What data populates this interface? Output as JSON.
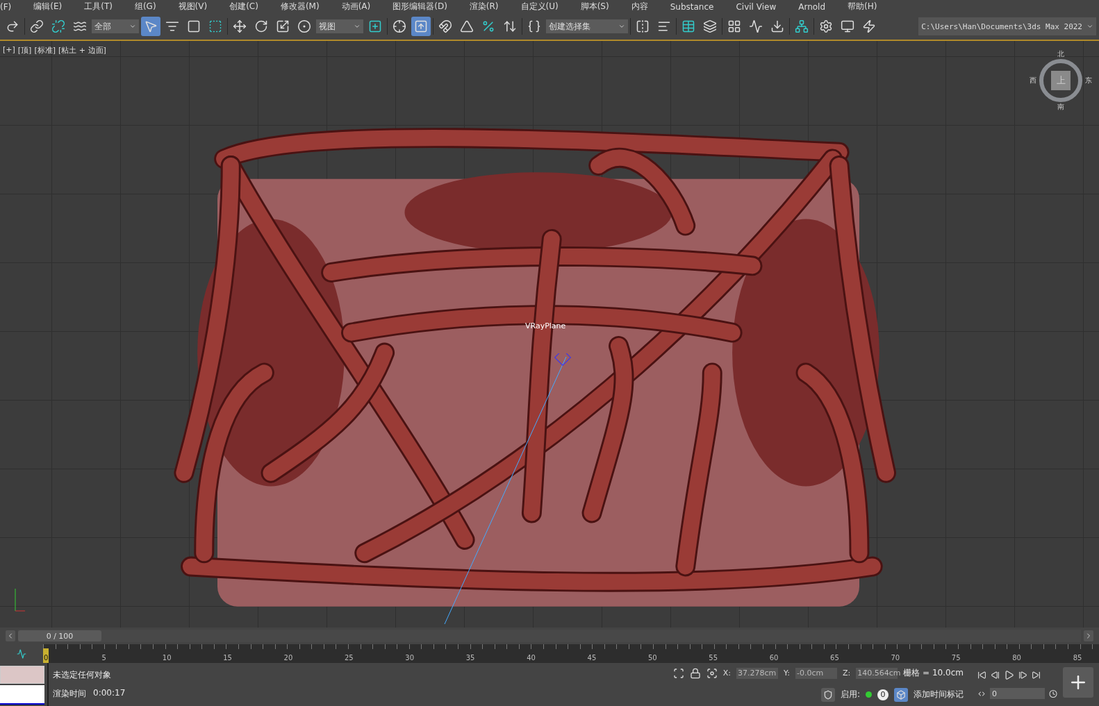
{
  "menu": [
    "(F)",
    "编辑(E)",
    "工具(T)",
    "组(G)",
    "视图(V)",
    "创建(C)",
    "修改器(M)",
    "动画(A)",
    "图形编辑器(D)",
    "渲染(R)",
    "自定义(U)",
    "脚本(S)",
    "内容",
    "Substance",
    "Civil View",
    "Arnold",
    "帮助(H)"
  ],
  "toolbar": [
    {
      "kind": "button",
      "selected": false
    },
    {
      "kind": "sep"
    },
    {
      "kind": "button",
      "selected": false
    },
    {
      "kind": "button",
      "selected": false
    },
    {
      "kind": "button",
      "selected": false
    },
    {
      "kind": "dropdown",
      "value": "全部"
    },
    {
      "kind": "button",
      "selected": true
    },
    {
      "kind": "button",
      "selected": false
    },
    {
      "kind": "button",
      "selected": false
    },
    {
      "kind": "button",
      "selected": false
    },
    {
      "kind": "sep"
    },
    {
      "kind": "button",
      "selected": false
    },
    {
      "kind": "button",
      "selected": false
    },
    {
      "kind": "button",
      "selected": false
    },
    {
      "kind": "button",
      "selected": false
    },
    {
      "kind": "dropdown",
      "value": "视图"
    },
    {
      "kind": "button",
      "selected": false
    },
    {
      "kind": "sep"
    },
    {
      "kind": "button",
      "selected": false
    },
    {
      "kind": "button",
      "selected": true
    },
    {
      "kind": "sep"
    },
    {
      "kind": "button",
      "selected": false
    },
    {
      "kind": "button",
      "selected": false
    },
    {
      "kind": "button",
      "selected": false
    },
    {
      "kind": "button",
      "selected": false
    },
    {
      "kind": "sep"
    },
    {
      "kind": "button",
      "selected": false
    },
    {
      "kind": "dropdown",
      "value": "创建选择集"
    },
    {
      "kind": "sep"
    },
    {
      "kind": "button",
      "selected": false
    },
    {
      "kind": "button",
      "selected": false
    },
    {
      "kind": "sep"
    },
    {
      "kind": "button",
      "selected": false
    },
    {
      "kind": "button",
      "selected": false
    },
    {
      "kind": "sep"
    },
    {
      "kind": "button",
      "selected": false
    },
    {
      "kind": "button",
      "selected": false
    },
    {
      "kind": "button",
      "selected": false
    },
    {
      "kind": "sep"
    },
    {
      "kind": "button",
      "selected": false
    },
    {
      "kind": "sep"
    },
    {
      "kind": "button",
      "selected": false
    },
    {
      "kind": "button",
      "selected": false
    },
    {
      "kind": "button",
      "selected": false
    },
    {
      "kind": "path",
      "value": "C:\\Users\\Han\\Documents\\3ds Max 2022"
    }
  ],
  "viewport": {
    "labels": [
      "[+]",
      "[顶]",
      "[标准]",
      "[粘土 + 边面]"
    ],
    "object_label": "VRayPlane",
    "viewcube": {
      "north": "北",
      "south": "南",
      "east": "东",
      "west": "西",
      "face": "上"
    }
  },
  "time_slider": {
    "frame": "0 / 100",
    "level": 0
  },
  "ruler": {
    "labels": [
      "0",
      "5",
      "10",
      "15",
      "20",
      "25",
      "30",
      "35",
      "40",
      "45",
      "50",
      "55",
      "60",
      "65",
      "70",
      "75",
      "80",
      "85"
    ]
  },
  "status": {
    "message": "未选定任何对象",
    "render_label": "渲染时间",
    "render_time": "0:00:17",
    "coords": [
      {
        "axis": "X:",
        "value": "37.278cm"
      },
      {
        "axis": "Y:",
        "value": "-0.0cm"
      },
      {
        "axis": "Z:",
        "value": "140.564cm"
      }
    ],
    "grid": "栅格 = 10.0cm",
    "enable_label": "启用:",
    "enable_count": "0",
    "add_time_tag": "添加时间标记",
    "frame_field": "0"
  }
}
